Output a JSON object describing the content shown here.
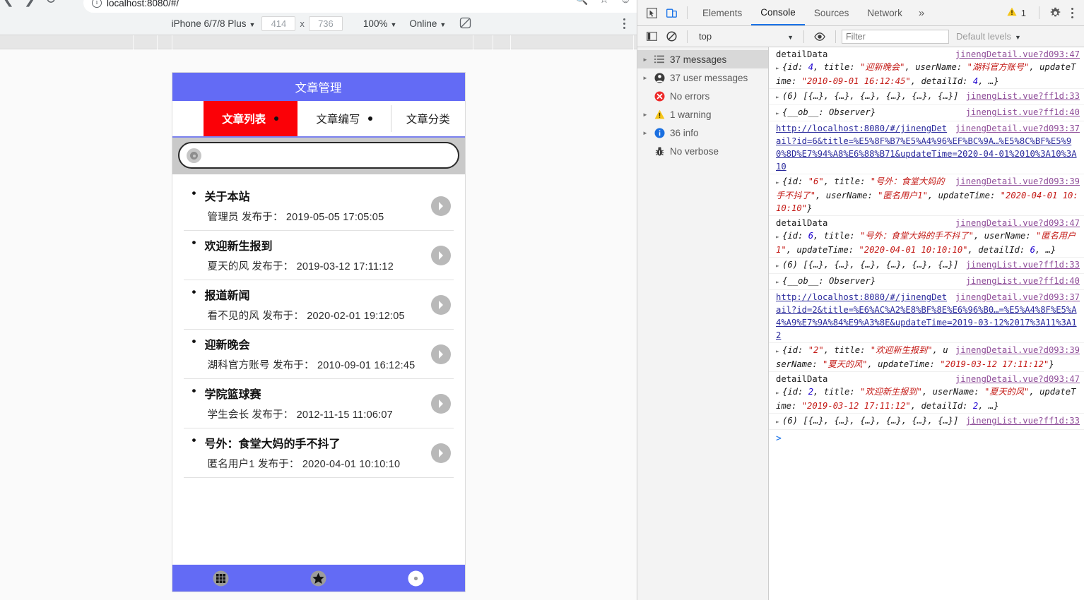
{
  "browser": {
    "url": "localhost:8080/#/",
    "back_icon": "back-arrow-icon",
    "forward_icon": "forward-arrow-icon",
    "reload_icon": "reload-icon",
    "info_icon": "info-icon",
    "search_icon": "search-icon",
    "bookmark_icon": "bookmark-star-icon",
    "profile_icon": "profile-avatar-icon"
  },
  "device_toolbar": {
    "device": "iPhone 6/7/8 Plus",
    "width": "414",
    "height": "736",
    "x_separator": "x",
    "zoom": "100%",
    "throttling": "Online",
    "rotate_icon": "rotate-device-icon",
    "menu_icon": "kebab-menu-icon"
  },
  "app": {
    "title": "文章管理",
    "tabs": [
      {
        "label": "文章列表",
        "active": true,
        "has_dot": true
      },
      {
        "label": "文章编写",
        "active": false,
        "has_dot": true
      },
      {
        "label": "文章分类",
        "active": false,
        "has_dot": false
      }
    ],
    "search": {
      "value": "",
      "placeholder": "",
      "icon": "search-icon"
    },
    "published_prefix": "发布于：",
    "articles": [
      {
        "title": "关于本站",
        "author": "管理员",
        "time": "2019-05-05 17:05:05"
      },
      {
        "title": "欢迎新生报到",
        "author": "夏天的风",
        "time": "2019-03-12 17:11:12"
      },
      {
        "title": "报道新闻",
        "author": "看不见的风",
        "time": "2020-02-01 19:12:05"
      },
      {
        "title": "迎新晚会",
        "author": "湖科官方账号",
        "time": "2010-09-01 16:12:45"
      },
      {
        "title": "学院篮球赛",
        "author": "学生会长",
        "time": "2012-11-15 11:06:07"
      },
      {
        "title": "号外：食堂大妈的手不抖了",
        "author": "匿名用户1",
        "time": "2020-04-01 10:10:10"
      }
    ],
    "bottom_nav": [
      {
        "icon": "apps-grid-icon"
      },
      {
        "icon": "star-icon"
      },
      {
        "icon": "gear-settings-icon"
      }
    ],
    "colors": {
      "header": "#636bf5",
      "active_tab": "#fb0107",
      "tab_underline": "#7b81ef"
    }
  },
  "devtools": {
    "inspect_icon": "inspect-element-icon",
    "device_toggle_icon": "toggle-device-toolbar-icon",
    "tabs": [
      {
        "label": "Elements",
        "active": false
      },
      {
        "label": "Console",
        "active": true
      },
      {
        "label": "Sources",
        "active": false
      },
      {
        "label": "Network",
        "active": false
      }
    ],
    "more_tabs": "»",
    "warning_count": "1",
    "warning_icon": "warning-triangle-icon",
    "settings_icon": "gear-settings-icon",
    "menu_icon": "kebab-menu-icon",
    "console_toolbar": {
      "sidebar_toggle_icon": "toggle-console-sidebar-icon",
      "clear_icon": "clear-console-icon",
      "context": "top",
      "eye_icon": "live-expression-icon",
      "filter_placeholder": "Filter",
      "filter_value": "",
      "levels": "Default levels"
    },
    "sidebar": [
      {
        "label": "37 messages",
        "icon": "list-icon",
        "expandable": true,
        "selected": true
      },
      {
        "label": "37 user messages",
        "icon": "user-icon",
        "expandable": true,
        "selected": false
      },
      {
        "label": "No errors",
        "icon": "error-circle-icon",
        "expandable": false,
        "selected": false
      },
      {
        "label": "1 warning",
        "icon": "warning-triangle-icon",
        "expandable": true,
        "selected": false
      },
      {
        "label": "36 info",
        "icon": "info-circle-icon",
        "expandable": true,
        "selected": false
      },
      {
        "label": "No verbose",
        "icon": "bug-icon",
        "expandable": false,
        "selected": false
      }
    ],
    "log": [
      {
        "type": "object",
        "label": "detailData",
        "source": "jinengDetail.vue?d093:47",
        "parts": [
          {
            "t": "{id: ",
            "c": "obj"
          },
          {
            "t": "4",
            "c": "num"
          },
          {
            "t": ", title: ",
            "c": "obj"
          },
          {
            "t": "\"迎新晚会\"",
            "c": "str"
          },
          {
            "t": ", userName: ",
            "c": "obj"
          },
          {
            "t": "\"湖科官方账号\"",
            "c": "str"
          },
          {
            "t": ", updateTime: ",
            "c": "obj"
          },
          {
            "t": "\"2010-09-01 16:12:45\"",
            "c": "str"
          },
          {
            "t": ", detailId: ",
            "c": "obj"
          },
          {
            "t": "4",
            "c": "num"
          },
          {
            "t": ", …}",
            "c": "obj"
          }
        ]
      },
      {
        "type": "array",
        "label": "",
        "source": "jinengList.vue?ff1d:33",
        "text": "(6) [{…}, {…}, {…}, {…}, {…}, {…}]"
      },
      {
        "type": "observer",
        "label": "",
        "source": "jinengList.vue?ff1d:40",
        "text": "{__ob__: Observer}"
      },
      {
        "type": "link",
        "source": "jinengDetail.vue?d093:37",
        "url": "http://localhost:8080/#/jinengDetail?id=6&title=%E5%8F%B7%E5%A4%96%EF%BC%9A…%E5%8C%BF%E5%90%8D%E7%94%A8%E6%88%B71&updateTime=2020-04-01%2010%3A10%3A10"
      },
      {
        "type": "object",
        "label": "",
        "source": "jinengDetail.vue?d093:39",
        "parts": [
          {
            "t": "{id: ",
            "c": "obj"
          },
          {
            "t": "\"6\"",
            "c": "str"
          },
          {
            "t": ", title: ",
            "c": "obj"
          },
          {
            "t": "\"号外：食堂大妈的手不抖了\"",
            "c": "str"
          },
          {
            "t": ", userName: ",
            "c": "obj"
          },
          {
            "t": "\"匿名用户1\"",
            "c": "str"
          },
          {
            "t": ", updateTime: ",
            "c": "obj"
          },
          {
            "t": "\"2020-04-01 10:10:10\"",
            "c": "str"
          },
          {
            "t": "}",
            "c": "obj"
          }
        ]
      },
      {
        "type": "object",
        "label": "detailData",
        "source": "jinengDetail.vue?d093:47",
        "parts": [
          {
            "t": "{id: ",
            "c": "obj"
          },
          {
            "t": "6",
            "c": "num"
          },
          {
            "t": ", title: ",
            "c": "obj"
          },
          {
            "t": "\"号外：食堂大妈的手不抖了\"",
            "c": "str"
          },
          {
            "t": ", userName: ",
            "c": "obj"
          },
          {
            "t": "\"匿名用户1\"",
            "c": "str"
          },
          {
            "t": ", updateTime: ",
            "c": "obj"
          },
          {
            "t": "\"2020-04-01 10:10:10\"",
            "c": "str"
          },
          {
            "t": ", detailId: ",
            "c": "obj"
          },
          {
            "t": "6",
            "c": "num"
          },
          {
            "t": ", …}",
            "c": "obj"
          }
        ]
      },
      {
        "type": "array",
        "label": "",
        "source": "jinengList.vue?ff1d:33",
        "text": "(6) [{…}, {…}, {…}, {…}, {…}, {…}]"
      },
      {
        "type": "observer",
        "label": "",
        "source": "jinengList.vue?ff1d:40",
        "text": "{__ob__: Observer}"
      },
      {
        "type": "link",
        "source": "jinengDetail.vue?d093:37",
        "url": "http://localhost:8080/#/jinengDetail?id=2&title=%E6%AC%A2%E8%BF%8E%E6%96%B0…=%E5%A4%8F%E5%A4%A9%E7%9A%84%E9%A3%8E&updateTime=2019-03-12%2017%3A11%3A12"
      },
      {
        "type": "object",
        "label": "",
        "source": "jinengDetail.vue?d093:39",
        "parts": [
          {
            "t": "{id: ",
            "c": "obj"
          },
          {
            "t": "\"2\"",
            "c": "str"
          },
          {
            "t": ", title: ",
            "c": "obj"
          },
          {
            "t": "\"欢迎新生报到\"",
            "c": "str"
          },
          {
            "t": ", userName: ",
            "c": "obj"
          },
          {
            "t": "\"夏天的风\"",
            "c": "str"
          },
          {
            "t": ", updateTime: ",
            "c": "obj"
          },
          {
            "t": "\"2019-03-12 17:11:12\"",
            "c": "str"
          },
          {
            "t": "}",
            "c": "obj"
          }
        ]
      },
      {
        "type": "object",
        "label": "detailData",
        "source": "jinengDetail.vue?d093:47",
        "parts": [
          {
            "t": "{id: ",
            "c": "obj"
          },
          {
            "t": "2",
            "c": "num"
          },
          {
            "t": ", title: ",
            "c": "obj"
          },
          {
            "t": "\"欢迎新生报到\"",
            "c": "str"
          },
          {
            "t": ", userName: ",
            "c": "obj"
          },
          {
            "t": "\"夏天的风\"",
            "c": "str"
          },
          {
            "t": ", updateTime: ",
            "c": "obj"
          },
          {
            "t": "\"2019-03-12 17:11:12\"",
            "c": "str"
          },
          {
            "t": ", detailId: ",
            "c": "obj"
          },
          {
            "t": "2",
            "c": "num"
          },
          {
            "t": ", …}",
            "c": "obj"
          }
        ]
      },
      {
        "type": "array",
        "label": "",
        "source": "jinengList.vue?ff1d:33",
        "text": "(6) [{…}, {…}, {…}, {…}, {…}, {…}]"
      }
    ],
    "prompt": ">"
  }
}
